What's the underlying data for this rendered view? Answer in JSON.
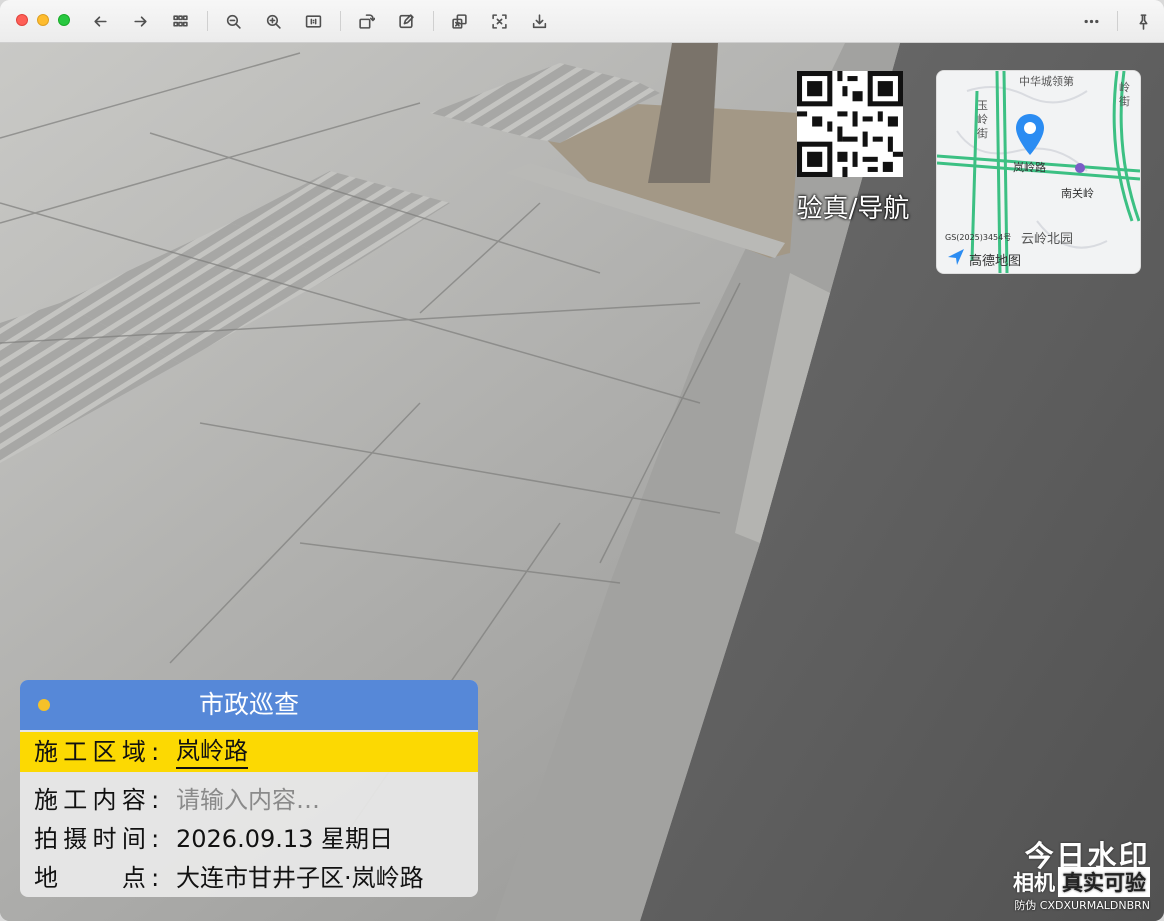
{
  "toolbar": {
    "buttons": [
      "back",
      "forward",
      "thumbnails",
      "zoom-out",
      "zoom-in",
      "actual-size",
      "rotate",
      "markup",
      "share-window",
      "crop",
      "download",
      "more",
      "pin"
    ]
  },
  "overlay": {
    "qr_label": "验真/导航",
    "map": {
      "labels": {
        "top": "中华城领第",
        "left_street": "玉岭街",
        "right_street": "岭街",
        "road": "岚岭路",
        "station": "南关岭",
        "park": "云岭北园",
        "license": "GS(2025)3454号",
        "provider": "高德地图"
      },
      "colors": {
        "road": "#3cc083",
        "pin": "#2b8cf2"
      }
    },
    "card": {
      "title": "市政巡查",
      "rows": [
        {
          "key": "施工区域:",
          "value": "岚岭路"
        },
        {
          "key": "施工内容:",
          "value": "请输入内容…"
        },
        {
          "key": "拍摄时间:",
          "value": "2026.09.13 星期日"
        },
        {
          "key": "地　　点:",
          "value": "大连市甘井子区·岚岭路"
        }
      ],
      "colors": {
        "header": "#5688d8",
        "highlight": "#fcd902",
        "dot": "#f5c128"
      }
    },
    "brand": {
      "main": "今日水印",
      "sub_prefix": "相机",
      "sub_box": "真实可验",
      "code": "防伪 CXDXURMALDNBRN"
    }
  }
}
